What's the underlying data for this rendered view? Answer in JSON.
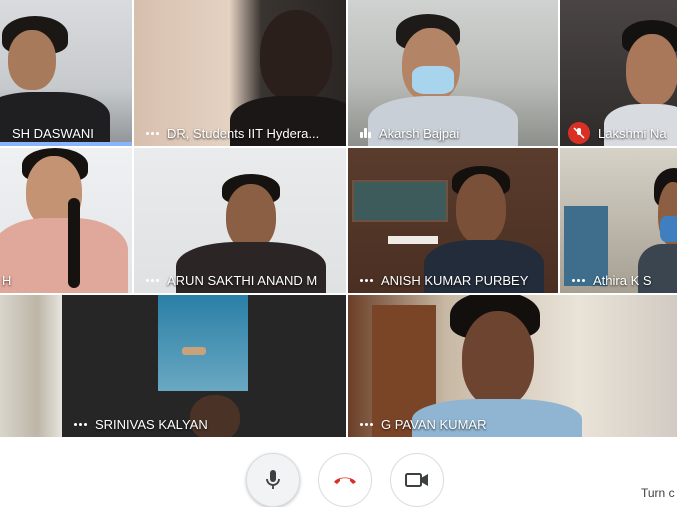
{
  "participants": [
    {
      "name": "SH DASWANI"
    },
    {
      "name": "DR, Students IIT Hydera..."
    },
    {
      "name": "Akarsh Bajpai"
    },
    {
      "name": "Lakshmi Na"
    },
    {
      "name": "H"
    },
    {
      "name": "ARUN SAKTHI ANAND M"
    },
    {
      "name": "ANISH KUMAR PURBEY"
    },
    {
      "name": "Athira K S"
    },
    {
      "name": "SRINIVAS KALYAN"
    },
    {
      "name": "G PAVAN KUMAR"
    }
  ],
  "controls": {
    "mic_icon": "microphone-icon",
    "hangup_icon": "phone-hangup-icon",
    "camera_icon": "video-camera-icon",
    "turn_text": "Turn c"
  },
  "colors": {
    "speaking": "#8ab4f8",
    "hangup": "#d93025",
    "muted": "#d93025"
  }
}
